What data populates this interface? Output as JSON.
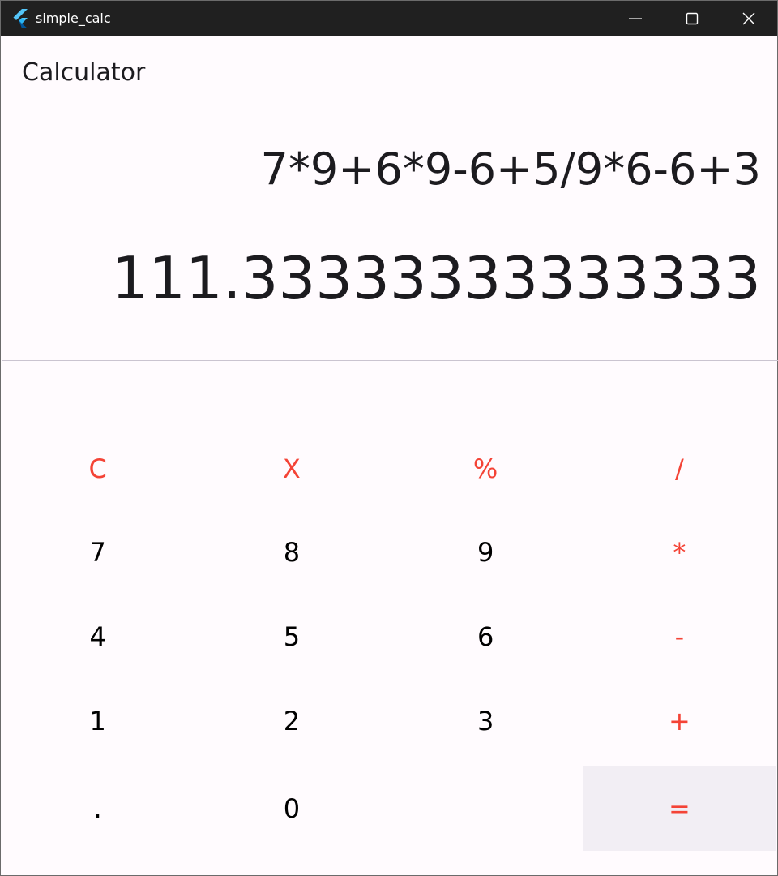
{
  "window": {
    "title": "simple_calc",
    "controls": [
      "minimize-icon",
      "maximize-icon",
      "close-icon"
    ]
  },
  "appbar": {
    "title": "Calculator"
  },
  "display": {
    "expression": "7*9+6*9-6+5/9*6-6+3",
    "result": "111.33333333333333"
  },
  "keypad": {
    "rows": [
      [
        {
          "label": "C",
          "type": "operator"
        },
        {
          "label": "X",
          "type": "operator"
        },
        {
          "label": "%",
          "type": "operator"
        },
        {
          "label": "/",
          "type": "operator"
        }
      ],
      [
        {
          "label": "7",
          "type": "digit"
        },
        {
          "label": "8",
          "type": "digit"
        },
        {
          "label": "9",
          "type": "digit"
        },
        {
          "label": "*",
          "type": "operator"
        }
      ],
      [
        {
          "label": "4",
          "type": "digit"
        },
        {
          "label": "5",
          "type": "digit"
        },
        {
          "label": "6",
          "type": "digit"
        },
        {
          "label": "-",
          "type": "operator"
        }
      ],
      [
        {
          "label": "1",
          "type": "digit"
        },
        {
          "label": "2",
          "type": "digit"
        },
        {
          "label": "3",
          "type": "digit"
        },
        {
          "label": "+",
          "type": "operator"
        }
      ],
      [
        {
          "label": ".",
          "type": "digit"
        },
        {
          "label": "0",
          "type": "digit"
        },
        {
          "label": "",
          "type": "blank"
        },
        {
          "label": "=",
          "type": "equals"
        }
      ]
    ]
  },
  "colors": {
    "titlebar": "#202020",
    "background": "#fffbfe",
    "operator_text": "#f44336",
    "digit_text": "#000000",
    "equals_bg": "#f2eef4",
    "divider": "#cac4d0"
  }
}
